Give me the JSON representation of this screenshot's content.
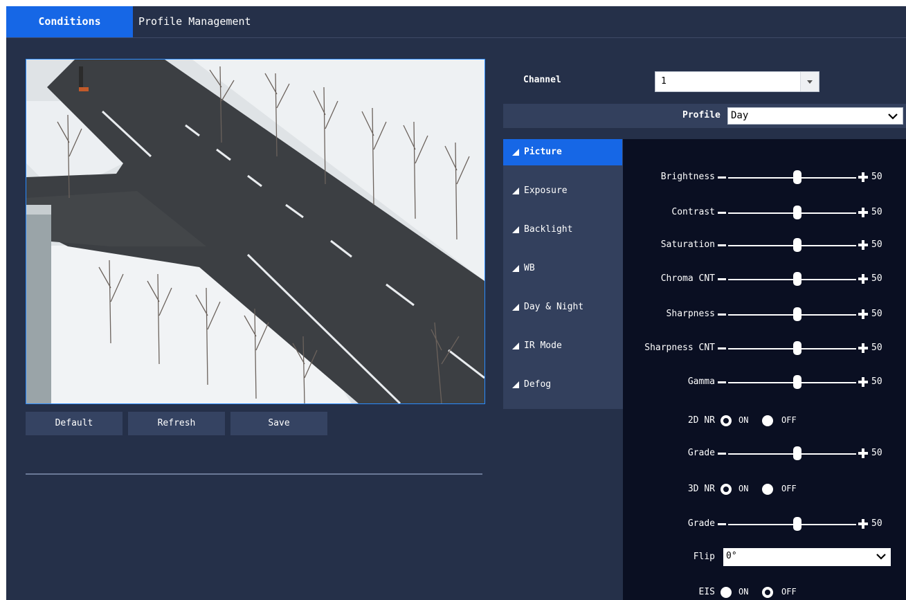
{
  "tabs": {
    "active": "Conditions",
    "second": "Profile Management"
  },
  "buttons": {
    "default": "Default",
    "refresh": "Refresh",
    "save": "Save"
  },
  "channel": {
    "label": "Channel",
    "value": "1"
  },
  "profile": {
    "label": "Profile",
    "value": "Day"
  },
  "menu": [
    "Picture",
    "Exposure",
    "Backlight",
    "WB",
    "Day & Night",
    "IR Mode",
    "Defog"
  ],
  "settings": {
    "brightness": {
      "label": "Brightness",
      "value": "50"
    },
    "contrast": {
      "label": "Contrast",
      "value": "50"
    },
    "saturation": {
      "label": "Saturation",
      "value": "50"
    },
    "chroma": {
      "label": "Chroma CNT",
      "value": "50"
    },
    "sharpness": {
      "label": "Sharpness",
      "value": "50"
    },
    "sharpness_cnt": {
      "label": "Sharpness CNT",
      "value": "50"
    },
    "gamma": {
      "label": "Gamma",
      "value": "50"
    },
    "nr2d": {
      "label": "2D NR",
      "on": "ON",
      "off": "OFF",
      "selected": "ON"
    },
    "grade1": {
      "label": "Grade",
      "value": "50"
    },
    "nr3d": {
      "label": "3D NR",
      "on": "ON",
      "off": "OFF",
      "selected": "ON"
    },
    "grade2": {
      "label": "Grade",
      "value": "50"
    },
    "flip": {
      "label": "Flip",
      "value": "0°"
    },
    "eis": {
      "label": "EIS",
      "on": "ON",
      "off": "OFF",
      "selected": "OFF"
    }
  },
  "colors": {
    "background": "#253049",
    "accent": "#1667e6",
    "panel": "#0a0f22",
    "submenu": "#33405d"
  },
  "icons": {
    "dropdown": "chevron-down-icon",
    "menu": "triangle-icon"
  }
}
